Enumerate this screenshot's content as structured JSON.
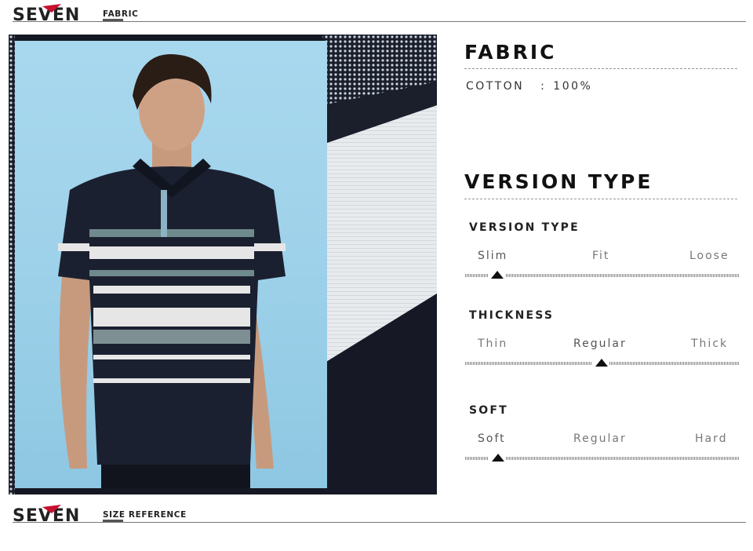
{
  "header_top": {
    "brand": "SEVEN",
    "section_label": "FABRIC"
  },
  "header_bottom": {
    "brand": "SEVEN",
    "section_label": "SIZE REFERENCE"
  },
  "fabric": {
    "title": "FABRIC",
    "material": "COTTON",
    "separator": ":",
    "percentage": "100%"
  },
  "version_type": {
    "title": "VERSION TYPE",
    "attributes": [
      {
        "name": "VERSION TYPE",
        "options": [
          "Slim",
          "Fit",
          "Loose"
        ],
        "selected_index": 0
      },
      {
        "name": "THICKNESS",
        "options": [
          "Thin",
          "Regular",
          "Thick"
        ],
        "selected_index": 1
      },
      {
        "name": "SOFT",
        "options": [
          "Soft",
          "Regular",
          "Hard"
        ],
        "selected_index": 0
      }
    ]
  },
  "colors": {
    "brand_red": "#c8102e",
    "ink": "#111111",
    "sky": "#9fd2ea",
    "shirt_navy": "#1b2030"
  }
}
